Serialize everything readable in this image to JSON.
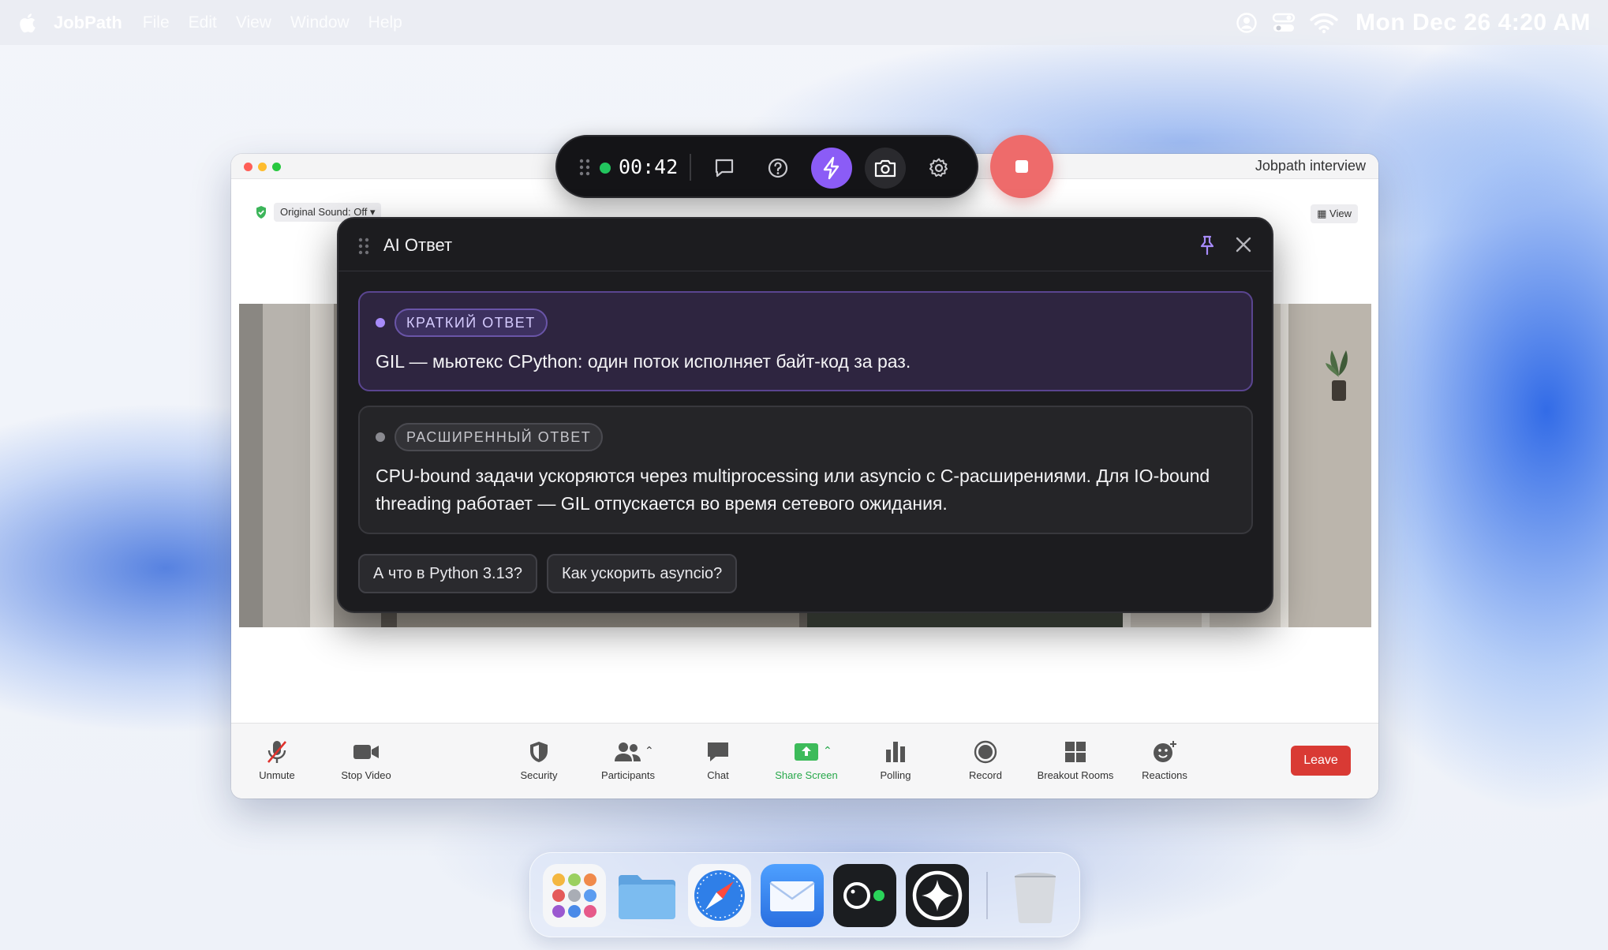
{
  "menubar": {
    "app_name": "JobPath",
    "menus": [
      "File",
      "Edit",
      "View",
      "Window",
      "Help"
    ],
    "clock": "Mon Dec 26  4:20 AM"
  },
  "zoom": {
    "window_title": "Jobpath interview",
    "original_sound": "Original Sound: Off",
    "view_label": "View",
    "toolbar": {
      "unmute": "Unmute",
      "stop_video": "Stop Video",
      "security": "Security",
      "participants": "Participants",
      "chat": "Chat",
      "share_screen": "Share Screen",
      "polling": "Polling",
      "record": "Record",
      "breakout_rooms": "Breakout Rooms",
      "reactions": "Reactions",
      "leave": "Leave"
    }
  },
  "control_bar": {
    "timer": "00:42",
    "status_color": "#22c55e",
    "accent": "#8b5cf6",
    "icons": [
      "drag-grip-icon",
      "chat-bubble-icon",
      "help-icon",
      "lightning-icon",
      "camera-icon",
      "gear-icon",
      "stop-icon"
    ]
  },
  "ai_panel": {
    "title": "AI Ответ",
    "short_answer": {
      "tag": "КРАТКИЙ ОТВЕТ",
      "text": "GIL — мьютекс CPython: один поток исполняет байт-код за раз."
    },
    "extended_answer": {
      "tag": "РАСШИРЕННЫЙ ОТВЕТ",
      "text": "CPU-bound задачи ускоряются через multiprocessing или asyncio с C-расширениями. Для IO-bound threading работает — GIL отпускается во время сетевого ожидания."
    },
    "followups": [
      "А что в Python 3.13?",
      "Как ускорить asyncio?"
    ]
  },
  "dock": {
    "apps": [
      "launchpad-icon",
      "finder-folder-icon",
      "safari-icon",
      "mail-icon",
      "jobpath-icon",
      "assistant-icon",
      "trash-icon"
    ]
  }
}
